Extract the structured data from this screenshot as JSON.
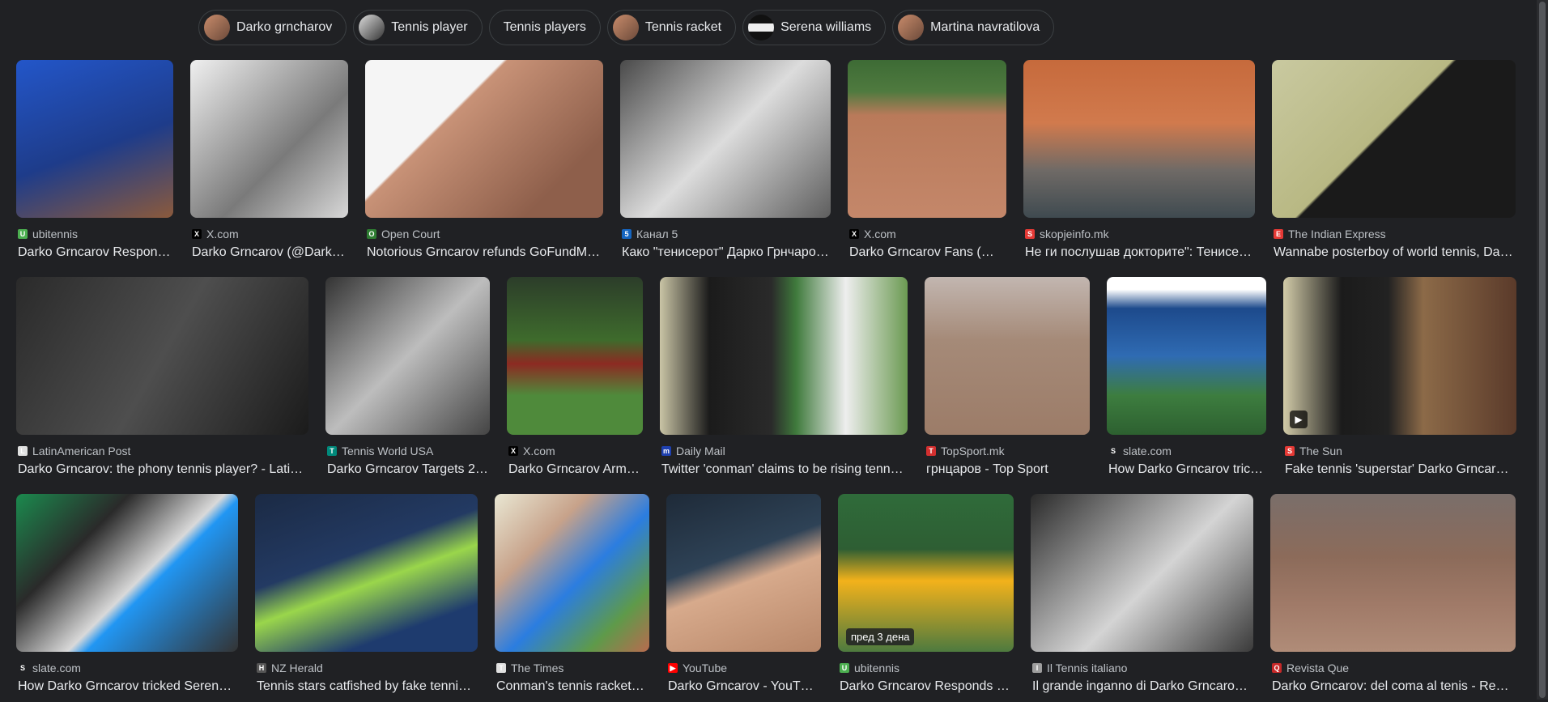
{
  "chips": [
    {
      "label": "Darko grncharov",
      "thumb": "skin"
    },
    {
      "label": "Tennis player",
      "thumb": "bw"
    },
    {
      "label": "Tennis players",
      "thumb": "none"
    },
    {
      "label": "Tennis racket",
      "thumb": "skin"
    },
    {
      "label": "Serena williams",
      "thumb": "stripe"
    },
    {
      "label": "Martina navratilova",
      "thumb": "skin"
    }
  ],
  "rows": [
    [
      {
        "source": "ubitennis",
        "title": "Darko Grncarov Respon…",
        "fav": "#4caf50",
        "favtext": "U",
        "bg": "linear-gradient(160deg,#2356c9,#1e3c8a 55%,#8b5a3c)"
      },
      {
        "source": "X.com",
        "title": "Darko Grncarov (@Dark…",
        "fav": "#000",
        "favtext": "X",
        "bg": "linear-gradient(135deg,#f0f0f0,#7a7a7a 60%,#d8d8d8)"
      },
      {
        "source": "Open Court",
        "title": "Notorious Grncarov refunds GoFundM…",
        "fav": "#2e7d32",
        "favtext": "O",
        "bg": "linear-gradient(135deg,#f5f5f5 0%,#f5f5f5 35%,#c89277 36%,#8e5f4b 80%)"
      },
      {
        "source": "Канал 5",
        "title": "Како \"тенисерот\" Дарко Грнчаро…",
        "fav": "#1565c0",
        "favtext": "5",
        "bg": "linear-gradient(135deg,#4a4a4a,#dcdcdc 50%,#5e5e5e)"
      },
      {
        "source": "X.com",
        "title": "Darko Grncarov Fans (…",
        "fav": "#000",
        "favtext": "X",
        "bg": "linear-gradient(180deg,#3d6b35 0%,#4f7a3f 20%,#b97a5a 35%,#c4876a 100%)"
      },
      {
        "source": "skopjeinfo.mk",
        "title": "Не ги послушав докторите\": Тенисе…",
        "fav": "#e53935",
        "favtext": "S",
        "bg": "linear-gradient(180deg,#c66a3c 0%,#d17a4d 40%,#6f6a66 70%,#3f4a50 100%)"
      },
      {
        "source": "The Indian Express",
        "title": "Wannabe posterboy of world tennis, Da…",
        "fav": "#e53935",
        "favtext": "E",
        "bg": "linear-gradient(135deg,#c9c9a0 0%,#b8b883 45%,#1a1a1a 46%,#1a1a1a 100%)"
      }
    ],
    [
      {
        "source": "LatinAmerican Post",
        "title": "Darko Grncarov: the phony tennis player? - Latin…",
        "fav": "#e0e0e0",
        "favtext": "L",
        "bg": "linear-gradient(120deg,#2a2a2a,#4e4e4e 50%,#1b1b1b)"
      },
      {
        "source": "Tennis World USA",
        "title": "Darko Grncarov Targets 2…",
        "fav": "#00897b",
        "favtext": "T",
        "bg": "linear-gradient(135deg,#333,#bdbdbd 50%,#444)"
      },
      {
        "source": "X.com",
        "title": "Darko Grncarov Arm…",
        "fav": "#000",
        "favtext": "X",
        "bg": "linear-gradient(180deg,#2c3d2a 0%,#3e6b2c 40%,#8c2a22 55%,#4f8a3b 75%)"
      },
      {
        "source": "Daily Mail",
        "title": "Twitter 'conman' claims to be rising tenni…",
        "fav": "#1e40af",
        "favtext": "m",
        "bg": "linear-gradient(90deg,#c9c4a5 0%,#1b1b1b 20%,#2a2a2a 45%,#3f7a3c 55%,#eeeeee 75%,#6b9a52 100%)"
      },
      {
        "source": "TopSport.mk",
        "title": "грнцаров - Top Sport",
        "fav": "#d32f2f",
        "favtext": "T",
        "bg": "linear-gradient(180deg,#c2b6b0 0%,#a58a78 40%,#9c7c68 100%)"
      },
      {
        "source": "slate.com",
        "title": "How Darko Grncarov tric…",
        "fav": "#202124",
        "favtext": "S",
        "bg": "linear-gradient(180deg,#ffffff 0%,#ffffff 8%,#1d4a8c 20%,#2f6bb3 50%,#3d7d3f 75%,#2d6030 100%)"
      },
      {
        "source": "The Sun",
        "title": "Fake tennis 'superstar' Darko Grncaro…",
        "fav": "#e53935",
        "favtext": "S",
        "bg": "linear-gradient(90deg,#d2cba8 0%,#1b1b1b 25%,#222 45%,#8c6a48 60%,#5a3a2a 100%)"
      }
    ],
    [
      {
        "source": "slate.com",
        "title": "How Darko Grncarov tricked Serena…",
        "fav": "#202124",
        "favtext": "S",
        "bg": "linear-gradient(135deg,#1b8a4e 0%,#2a2a2a 30%,#d9d9d9 55%,#2196f3 60%,#333 100%)"
      },
      {
        "source": "NZ Herald",
        "title": "Tennis stars catfished by fake tennis…",
        "fav": "#555",
        "favtext": "H",
        "bg": "linear-gradient(160deg,#1b2a44 0%,#233a63 40%,#9ad64b 55%,#1e3b6e 80%)"
      },
      {
        "source": "The Times",
        "title": "Conman's tennis racket…",
        "fav": "#e0e0e0",
        "favtext": "T",
        "bg": "linear-gradient(135deg,#e9e7d3 0%,#c7a28a 30%,#2b7de0 55%,#5e9a4a 80%,#b86b4f 100%)"
      },
      {
        "source": "YouTube",
        "title": "Darko Grncarov - YouT…",
        "fav": "#ff0000",
        "favtext": "▶",
        "bg": "linear-gradient(160deg,#1e2a38 0%,#2e4256 40%,#d7aa8c 55%,#b88769 100%)"
      },
      {
        "source": "ubitennis",
        "title": "Darko Grncarov Responds …",
        "fav": "#4caf50",
        "favtext": "U",
        "bg": "linear-gradient(180deg,#2f6b3a 0%,#2e5e33 35%,#f3b21b 55%,#4d7a3f 100%)"
      },
      {
        "source": "Il Tennis italiano",
        "title": "Il grande inganno di Darko Grncarov…",
        "fav": "#9e9e9e",
        "favtext": "I",
        "bg": "linear-gradient(135deg,#2a2a2a,#d4d4d4 55%,#3a3a3a)"
      },
      {
        "source": "Revista Que",
        "title": "Darko Grncarov: del coma al tenis - Rev…",
        "fav": "#c62828",
        "favtext": "Q",
        "bg": "linear-gradient(180deg,#7a6e6a 0%,#8c6b5a 40%,#a07a68 70%,#b08c78 100%)"
      }
    ]
  ],
  "badges": {
    "r2c4": "пред 3 дена"
  }
}
